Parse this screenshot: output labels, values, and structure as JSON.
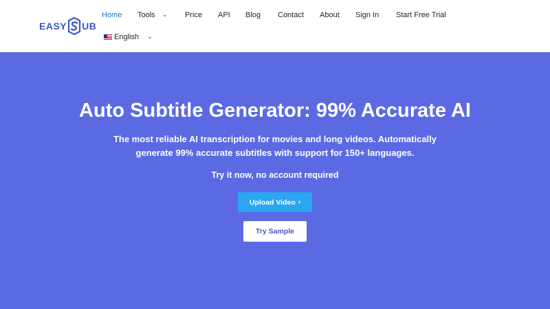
{
  "brand": {
    "logo_left": "EASY",
    "logo_right": "UB",
    "color": "#3c55c8"
  },
  "nav": {
    "items": [
      {
        "label": "Home",
        "active": true
      },
      {
        "label": "Tools",
        "dropdown": true
      },
      {
        "label": "Price"
      },
      {
        "label": "API"
      },
      {
        "label": "Blog"
      },
      {
        "label": "Contact"
      },
      {
        "label": "About"
      },
      {
        "label": "Sign In"
      },
      {
        "label": "Start Free Trial"
      }
    ],
    "active_color": "#1e73be",
    "language": {
      "label": "English",
      "flag": "us-flag-icon",
      "dropdown": true
    }
  },
  "hero": {
    "background": "#5b6ae3",
    "title": "Auto Subtitle Generator: 99% Accurate AI",
    "subtitle_line1": "The most reliable AI transcription for movies and long videos. Automatically",
    "subtitle_line2": "generate 99% accurate subtitles with support for 150+ languages.",
    "try_text": "Try it now, no account required",
    "upload_button": {
      "label": "Upload Video",
      "icon": "chevron-right-icon",
      "color": "#2aa6f2"
    },
    "sample_button": {
      "label": "Try Sample"
    }
  }
}
